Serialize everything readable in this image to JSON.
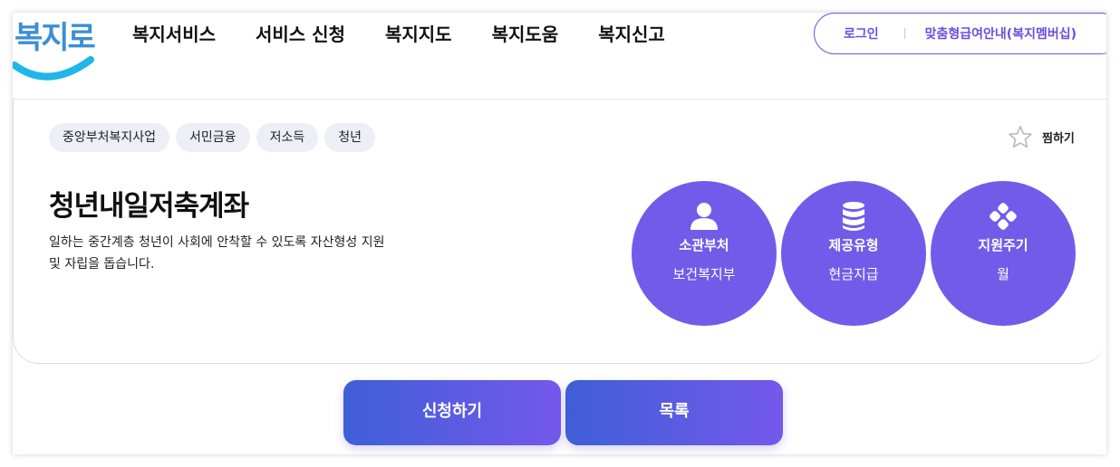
{
  "header": {
    "logo_text": "복지로",
    "nav": [
      "복지서비스",
      "서비스 신청",
      "복지지도",
      "복지도움",
      "복지신고"
    ],
    "login_label": "로그인",
    "member_label": "맞춤형급여안내(복지멤버십)"
  },
  "service": {
    "tags": [
      "중앙부처복지사업",
      "서민금융",
      "저소득",
      "청년"
    ],
    "favorite_label": "찜하기",
    "title": "청년내일저축계좌",
    "description": "일하는 중간계층 청년이 사회에 안착할 수 있도록 자산형성 지원 및 자립을 돕습니다.",
    "info": [
      {
        "icon": "person-icon",
        "label": "소관부처",
        "value": "보건복지부"
      },
      {
        "icon": "database-icon",
        "label": "제공유형",
        "value": "현금지급"
      },
      {
        "icon": "dots-icon",
        "label": "지원주기",
        "value": "월"
      }
    ]
  },
  "actions": {
    "apply_label": "신청하기",
    "list_label": "목록"
  },
  "colors": {
    "accent": "#735bea",
    "button_start": "#3f5fd6",
    "button_end": "#7458ec",
    "logo_blue": "#3a8fd6",
    "logo_swoosh": "#1fb6e8"
  }
}
